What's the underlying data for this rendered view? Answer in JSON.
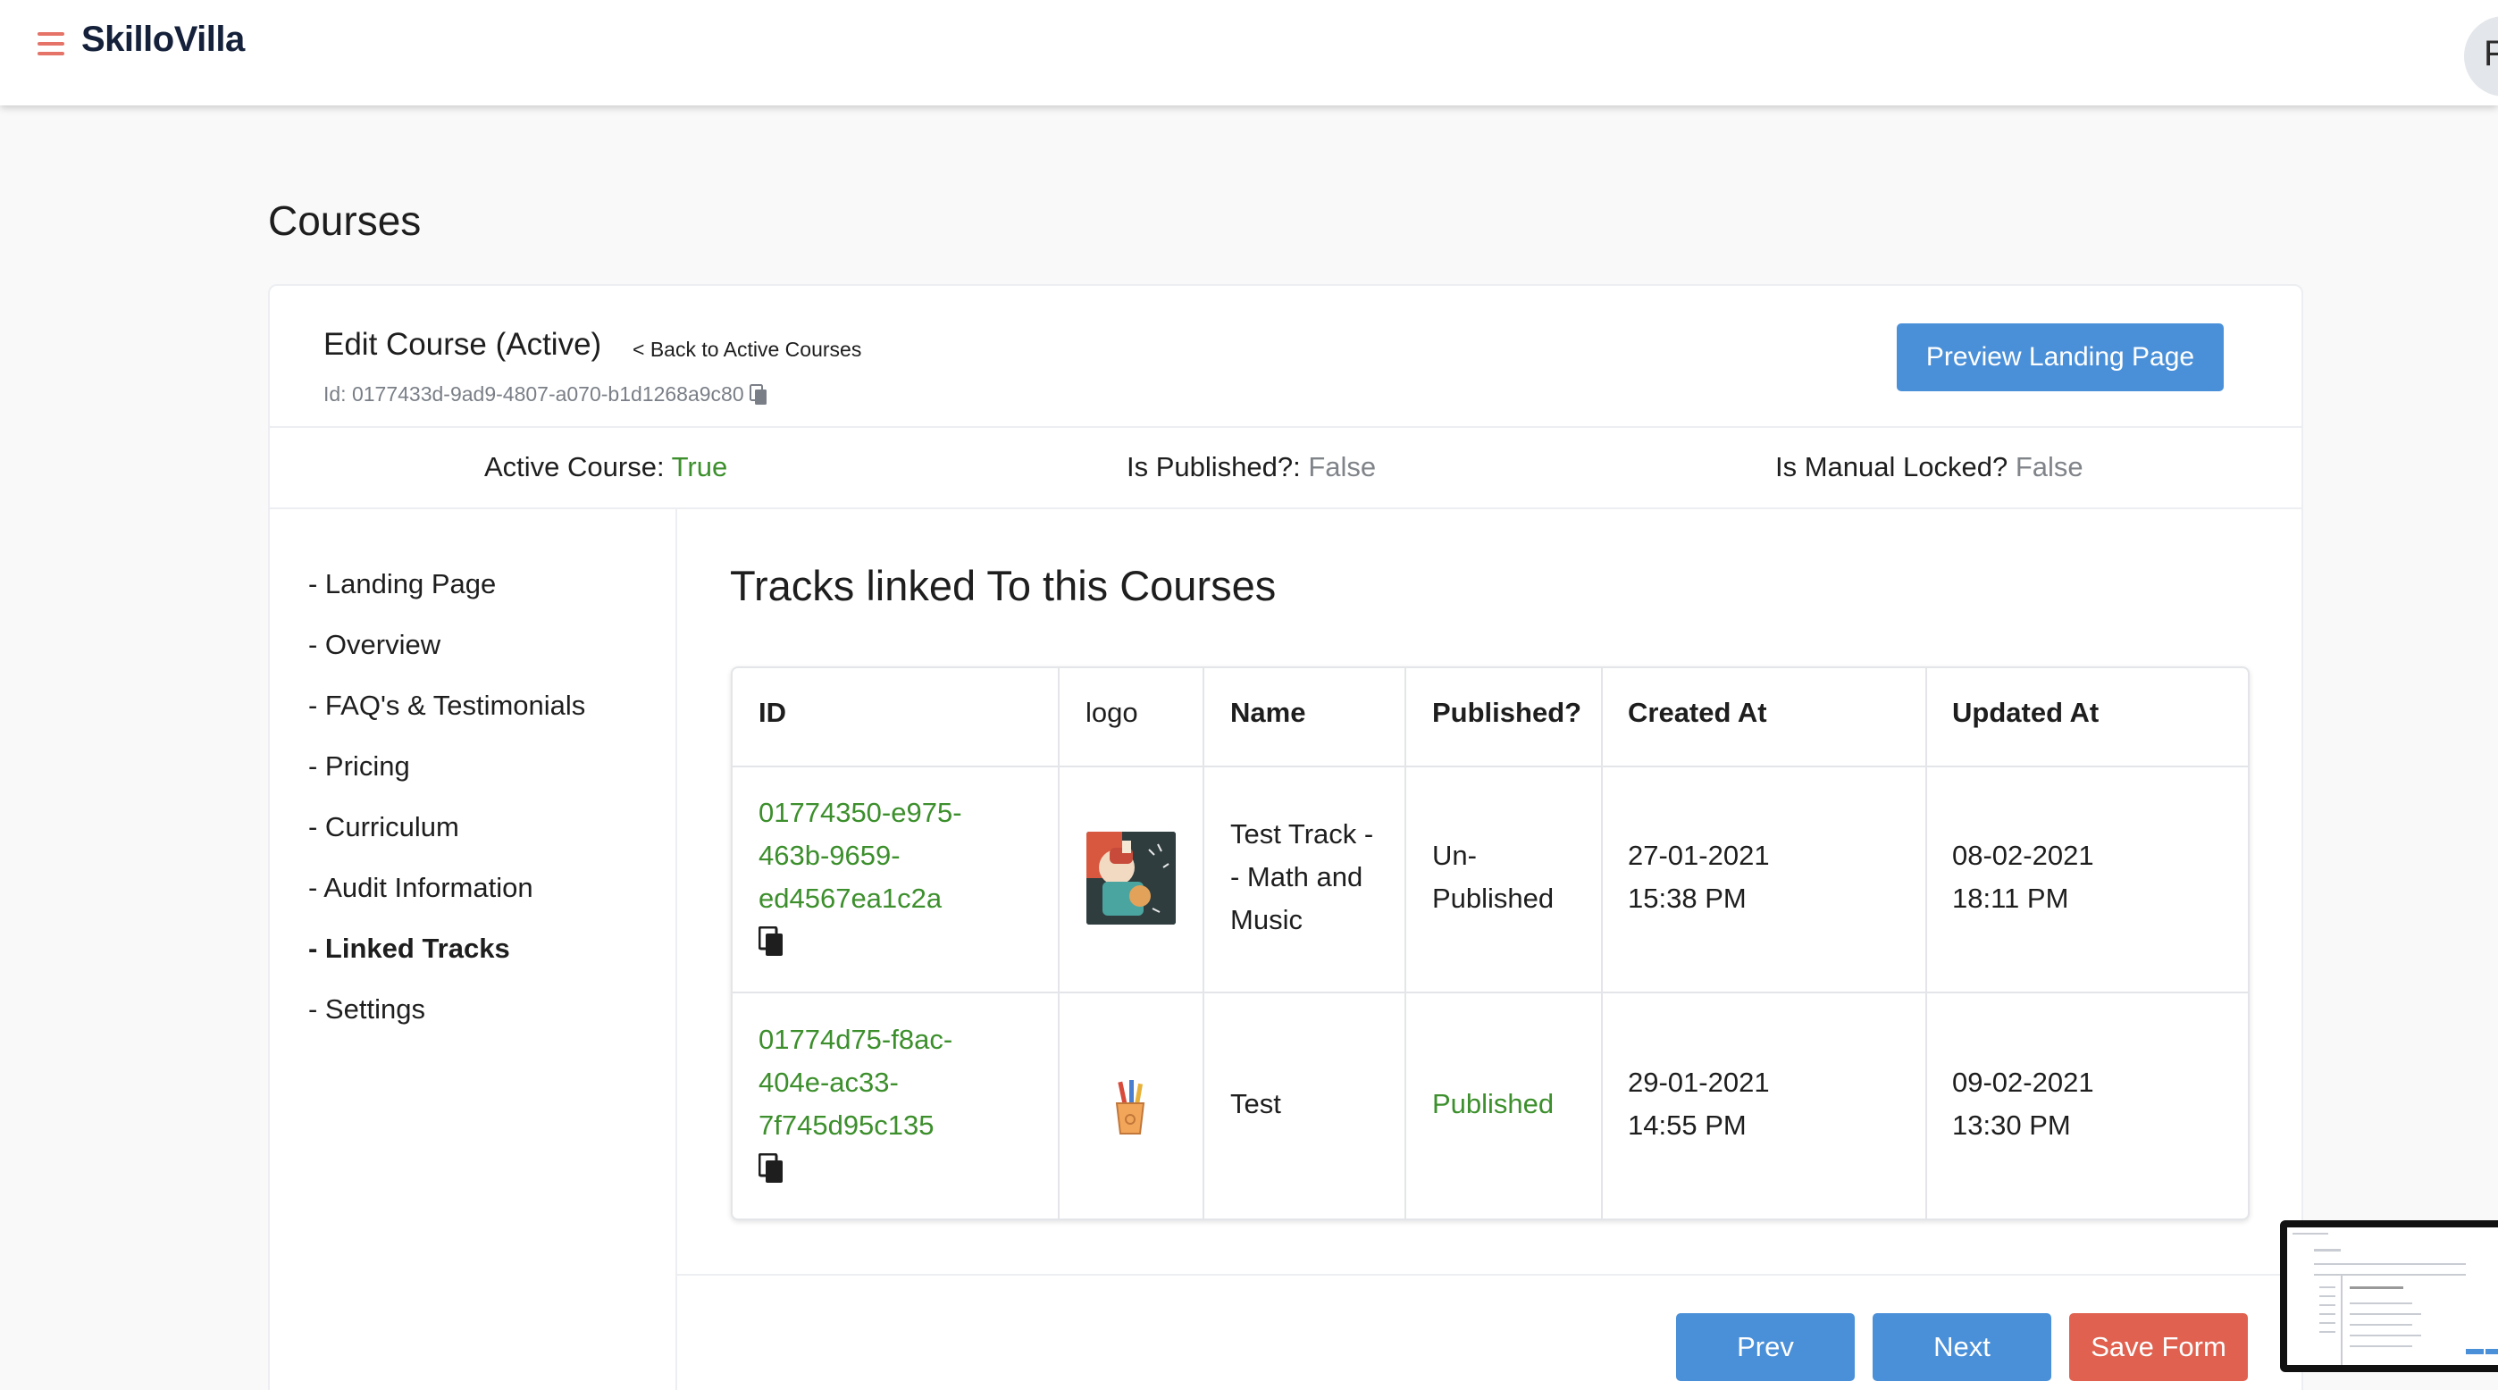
{
  "app": {
    "brand": "SkilloVilla",
    "avatar_initial": "F"
  },
  "page": {
    "title": "Courses"
  },
  "course": {
    "edit_title": "Edit Course (Active)",
    "back_link": "< Back to Active Courses",
    "id": "Id: 0177433d-9ad9-4807-a070-b1d1268a9c80",
    "preview_button": "Preview Landing Page"
  },
  "status": {
    "active_label": "Active Course:",
    "active_value": "True",
    "published_label": "Is Published?:",
    "published_value": "False",
    "locked_label": "Is Manual Locked?",
    "locked_value": "False"
  },
  "sidebar": {
    "items": [
      {
        "label": "- Landing Page"
      },
      {
        "label": "- Overview"
      },
      {
        "label": "- FAQ's & Testimonials"
      },
      {
        "label": "- Pricing"
      },
      {
        "label": "- Curriculum"
      },
      {
        "label": "- Audit Information"
      },
      {
        "label": "- Linked Tracks",
        "active": true
      },
      {
        "label": "- Settings"
      }
    ]
  },
  "tracks": {
    "title": "Tracks linked To this Courses",
    "columns": [
      "ID",
      "logo",
      "Name",
      "Published?",
      "Created At",
      "Updated At"
    ],
    "rows": [
      {
        "id_lines": [
          "01774350-e975-",
          "463b-9659-",
          "ed4567ea1c2a"
        ],
        "logo_icon": "music-math-thumbnail",
        "name_lines": [
          "Test Track -",
          "- Math and",
          "Music"
        ],
        "published_lines": [
          "Un-",
          "Published"
        ],
        "created_lines": [
          "27-01-2021",
          "15:38 PM"
        ],
        "updated_lines": [
          "08-02-2021",
          "18:11 PM"
        ]
      },
      {
        "id_lines": [
          "01774d75-f8ac-",
          "404e-ac33-",
          "7f745d95c135"
        ],
        "logo_icon": "pencil-cup-thumbnail",
        "name_lines": [
          "Test"
        ],
        "published_lines": [
          "Published"
        ],
        "created_lines": [
          "29-01-2021",
          "14:55 PM"
        ],
        "updated_lines": [
          "09-02-2021",
          "13:30 PM"
        ]
      }
    ]
  },
  "footer": {
    "prev": "Prev",
    "next": "Next",
    "save": "Save Form"
  },
  "colors": {
    "primary": "#4a90d9",
    "danger": "#e0614f",
    "success": "#3c8f2c",
    "muted": "#808489",
    "brand_icon": "#e57367"
  }
}
